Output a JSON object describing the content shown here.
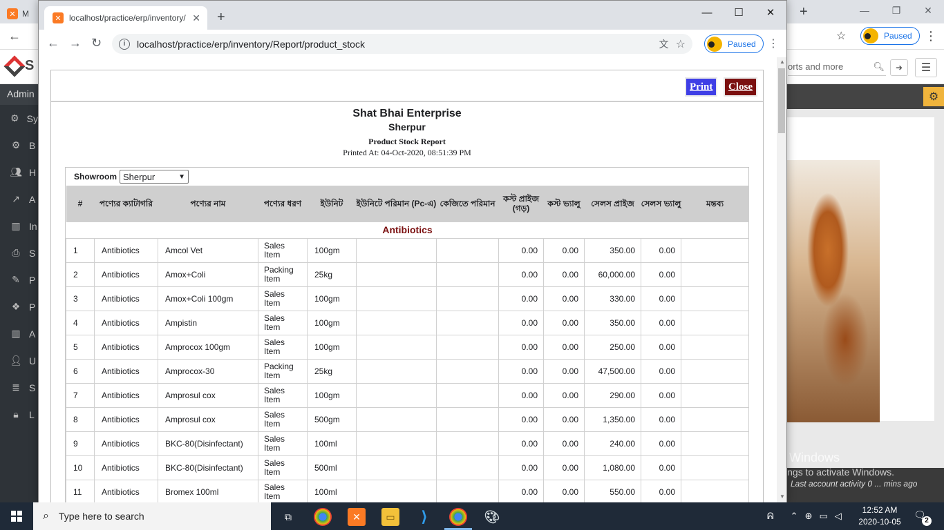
{
  "background_browser": {
    "tab_letter": "M",
    "paused_label": "Paused",
    "logo_letter": "S",
    "search_placeholder": "orts and more",
    "sidebar_head": "Admin",
    "sidebar_items": [
      {
        "icon": "cogs-icon",
        "label": "Sy"
      },
      {
        "icon": "cogs-icon",
        "label": "B"
      },
      {
        "icon": "users-icon",
        "label": "H"
      },
      {
        "icon": "chart-icon",
        "label": "A"
      },
      {
        "icon": "bar-chart-icon",
        "label": "In"
      },
      {
        "icon": "printer-icon",
        "label": "S"
      },
      {
        "icon": "pencil-icon",
        "label": "P"
      },
      {
        "icon": "cubes-icon",
        "label": "P"
      },
      {
        "icon": "bar-chart-icon",
        "label": "A"
      },
      {
        "icon": "user-icon",
        "label": "U"
      },
      {
        "icon": "database-icon",
        "label": "S"
      },
      {
        "icon": "lock-icon",
        "label": "L"
      }
    ],
    "activate_title": "Activate Windows",
    "activate_sub": "Go to Settings to activate Windows.",
    "last_activity": "Last account activity 0 ... mins ago"
  },
  "popup": {
    "tab_title": "localhost/practice/erp/inventory/",
    "url": "localhost/practice/erp/inventory/Report/product_stock",
    "paused_label": "Paused"
  },
  "report": {
    "print_label": "Print",
    "close_label": "Close",
    "company": "Shat Bhai Enterprise",
    "branch": "Sherpur",
    "title": "Product Stock Report",
    "printed_at": "Printed At: 04-Oct-2020, 08:51:39 PM",
    "showroom_label": "Showroom",
    "showroom_value": "Sherpur",
    "columns": [
      "#",
      "পণ্যের ক্যাটাগরি",
      "পণ্যের নাম",
      "পণ্যের ধরণ",
      "ইউনিট",
      "ইউনিটে পরিমান (Pc-এ)",
      "কেজিতে পরিমান",
      "কস্ট প্রাইজ (গড়)",
      "কস্ট ভ্যালু",
      "সেলস প্রাইজ",
      "সেলস ভ্যালু",
      "মন্তব্য"
    ],
    "category": "Antibiotics",
    "rows": [
      {
        "no": "1",
        "category": "Antibiotics",
        "name": "Amcol Vet",
        "type": "Sales Item",
        "unit": "100gm",
        "cost_price": "0.00",
        "cost_value": "0.00",
        "sales_price": "350.00",
        "sales_value": "0.00"
      },
      {
        "no": "2",
        "category": "Antibiotics",
        "name": "Amox+Coli",
        "type": "Packing Item",
        "unit": "25kg",
        "cost_price": "0.00",
        "cost_value": "0.00",
        "sales_price": "60,000.00",
        "sales_value": "0.00"
      },
      {
        "no": "3",
        "category": "Antibiotics",
        "name": "Amox+Coli 100gm",
        "type": "Sales Item",
        "unit": "100gm",
        "cost_price": "0.00",
        "cost_value": "0.00",
        "sales_price": "330.00",
        "sales_value": "0.00"
      },
      {
        "no": "4",
        "category": "Antibiotics",
        "name": "Ampistin",
        "type": "Sales Item",
        "unit": "100gm",
        "cost_price": "0.00",
        "cost_value": "0.00",
        "sales_price": "350.00",
        "sales_value": "0.00"
      },
      {
        "no": "5",
        "category": "Antibiotics",
        "name": "Amprocox 100gm",
        "type": "Sales Item",
        "unit": "100gm",
        "cost_price": "0.00",
        "cost_value": "0.00",
        "sales_price": "250.00",
        "sales_value": "0.00"
      },
      {
        "no": "6",
        "category": "Antibiotics",
        "name": "Amprocox-30",
        "type": "Packing Item",
        "unit": "25kg",
        "cost_price": "0.00",
        "cost_value": "0.00",
        "sales_price": "47,500.00",
        "sales_value": "0.00"
      },
      {
        "no": "7",
        "category": "Antibiotics",
        "name": "Amprosul cox",
        "type": "Sales Item",
        "unit": "100gm",
        "cost_price": "0.00",
        "cost_value": "0.00",
        "sales_price": "290.00",
        "sales_value": "0.00"
      },
      {
        "no": "8",
        "category": "Antibiotics",
        "name": "Amprosul cox",
        "type": "Sales Item",
        "unit": "500gm",
        "cost_price": "0.00",
        "cost_value": "0.00",
        "sales_price": "1,350.00",
        "sales_value": "0.00"
      },
      {
        "no": "9",
        "category": "Antibiotics",
        "name": "BKC-80(Disinfectant)",
        "type": "Sales Item",
        "unit": "100ml",
        "cost_price": "0.00",
        "cost_value": "0.00",
        "sales_price": "240.00",
        "sales_value": "0.00"
      },
      {
        "no": "10",
        "category": "Antibiotics",
        "name": "BKC-80(Disinfectant)",
        "type": "Sales Item",
        "unit": "500ml",
        "cost_price": "0.00",
        "cost_value": "0.00",
        "sales_price": "1,080.00",
        "sales_value": "0.00"
      },
      {
        "no": "11",
        "category": "Antibiotics",
        "name": "Bromex 100ml",
        "type": "Sales Item",
        "unit": "100ml",
        "cost_price": "0.00",
        "cost_value": "0.00",
        "sales_price": "550.00",
        "sales_value": "0.00"
      }
    ]
  },
  "taskbar": {
    "search_placeholder": "Type here to search",
    "time": "12:52 AM",
    "date": "2020-10-05",
    "notification_count": "2"
  },
  "colors": {
    "print_button": "#3f3fe6",
    "close_button": "#7b1010",
    "category_text": "#7b1010",
    "table_header": "#cfcfcf"
  }
}
